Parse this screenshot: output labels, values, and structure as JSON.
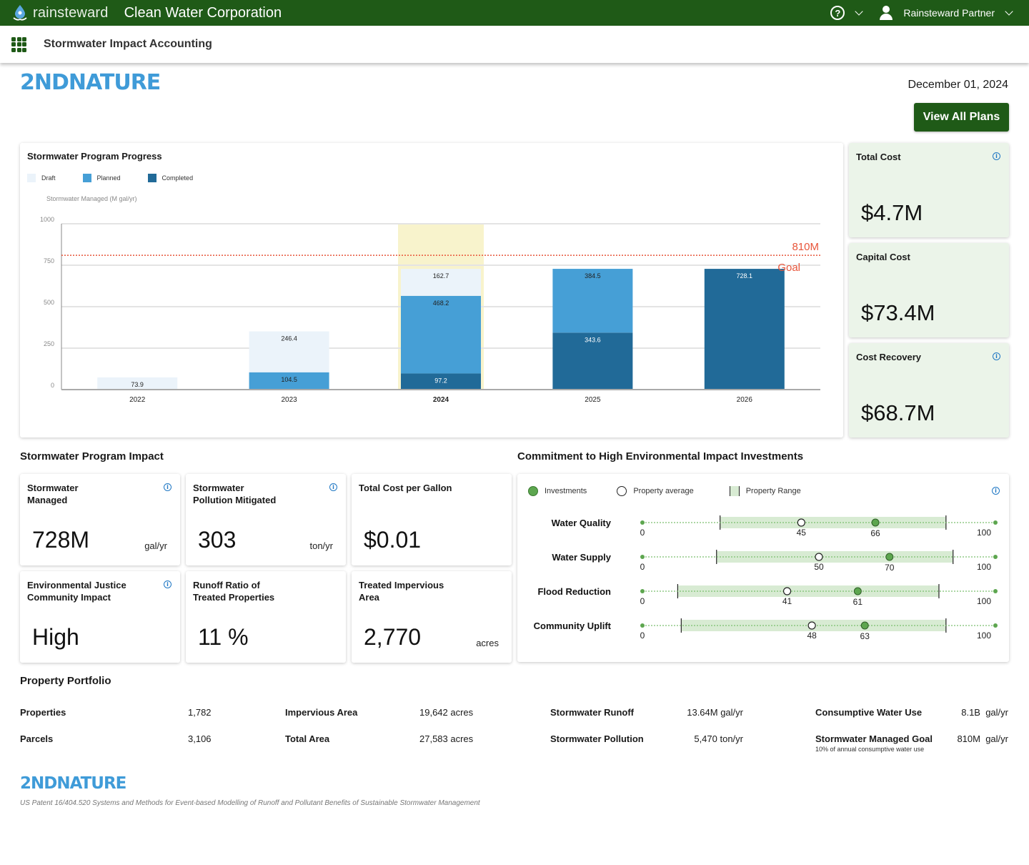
{
  "topbar": {
    "brand_name": "rainsteward",
    "org_name": "Clean Water Corporation",
    "help_icon": "question-circle-icon",
    "user_icon": "user-icon",
    "user_name": "Rainsteward Partner"
  },
  "subbar": {
    "apps_icon": "grid-apps-icon",
    "title": "Stormwater Impact Accounting"
  },
  "logo_text": "2NDNATURE",
  "date": "December 01,  2024",
  "view_all_plans_label": "View All Plans",
  "chart_card": {
    "title": "Stormwater Program Progress"
  },
  "chart_data": {
    "type": "bar",
    "stacked": true,
    "title": "Stormwater Program Progress",
    "xlabel": "",
    "ylabel": "Stormwater Managed (M gal/yr)",
    "ylim": [
      0,
      1000
    ],
    "yticks": [
      0,
      250,
      500,
      750,
      1000
    ],
    "categories": [
      "2022",
      "2023",
      "2024",
      "2025",
      "2026"
    ],
    "highlight_category": "2024",
    "series": [
      {
        "name": "Completed",
        "color": "#216a98",
        "values": [
          0,
          0,
          97.2,
          343.6,
          728.1
        ],
        "labels": [
          null,
          null,
          "97.2",
          "343.6",
          "728.1"
        ]
      },
      {
        "name": "Planned",
        "color": "#469fd6",
        "values": [
          0,
          104.5,
          468.2,
          384.5,
          0
        ],
        "labels": [
          null,
          "104.5",
          "468.2",
          "384.5",
          null
        ]
      },
      {
        "name": "Draft",
        "color": "#ebf3fa",
        "values": [
          73.9,
          246.4,
          162.7,
          0,
          0
        ],
        "labels": [
          "73.9",
          "246.4",
          "162.7",
          null,
          null
        ]
      }
    ],
    "legend": [
      "Draft",
      "Planned",
      "Completed"
    ],
    "legend_position": "top-left",
    "grid": true,
    "goal_line": {
      "value": 810,
      "label_top": "810M",
      "label_bottom": "Goal",
      "color": "#e8553a"
    }
  },
  "cost_cards": [
    {
      "title": "Total Cost",
      "value": "$4.7M",
      "info": true
    },
    {
      "title": "Capital Cost",
      "value": "$73.4M",
      "info": false
    },
    {
      "title": "Cost Recovery",
      "value": "$68.7M",
      "info": true
    }
  ],
  "impact_section": {
    "title": "Stormwater Program Impact",
    "cards": [
      {
        "title_line1": "Stormwater",
        "title_line2": "Managed",
        "value": "728M",
        "unit": "gal/yr",
        "info": true
      },
      {
        "title_line1": "Stormwater",
        "title_line2": "Pollution Mitigated",
        "value": "303",
        "unit": "ton/yr",
        "info": true
      },
      {
        "title_line1": "Total Cost per Gallon",
        "title_line2": "",
        "value": "$0.01",
        "unit": "",
        "info": false
      },
      {
        "title_line1": "Environmental Justice",
        "title_line2": "Community Impact",
        "value": "High",
        "unit": "",
        "info": true
      },
      {
        "title_line1": "Runoff Ratio of",
        "title_line2": "Treated Properties",
        "value": "11 %",
        "unit": "",
        "info": false
      },
      {
        "title_line1": "Treated Impervious",
        "title_line2": "Area",
        "value": "2,770",
        "unit": "acres",
        "info": false
      }
    ]
  },
  "commitment": {
    "title": "Commitment to High Environmental Impact Investments",
    "legend": {
      "investments": "Investments",
      "average": "Property average",
      "range": "Property Range"
    },
    "scale_min": "0",
    "scale_max": "100",
    "rows": [
      {
        "label": "Water Quality",
        "average": 45,
        "investment": 66,
        "range_min": 22,
        "range_max": 86
      },
      {
        "label": "Water Supply",
        "average": 50,
        "investment": 70,
        "range_min": 21,
        "range_max": 88
      },
      {
        "label": "Flood Reduction",
        "average": 41,
        "investment": 61,
        "range_min": 10,
        "range_max": 84
      },
      {
        "label": "Community Uplift",
        "average": 48,
        "investment": 63,
        "range_min": 11,
        "range_max": 86
      }
    ]
  },
  "portfolio": {
    "title": "Property Portfolio",
    "items": [
      {
        "label": "Properties",
        "value": "1,782"
      },
      {
        "label": "Parcels",
        "value": "3,106"
      },
      {
        "label": "Impervious Area",
        "value": "19,642 acres"
      },
      {
        "label": "Total Area",
        "value": "27,583 acres"
      },
      {
        "label": "Stormwater Runoff",
        "value": "13.64M gal/yr"
      },
      {
        "label": "Stormwater Pollution",
        "value": "5,470 ton/yr"
      },
      {
        "label": "Consumptive Water Use",
        "value": "8.1B  gal/yr"
      },
      {
        "label": "Stormwater Managed Goal",
        "value": "810M  gal/yr",
        "sub": "10% of annual consumptive water use"
      }
    ]
  },
  "footer": {
    "logo_text": "2NDNATURE",
    "patent": "US Patent 16/404.520 Systems and Methods for Event-based Modelling of Runoff and Pollutant Benefits of Sustainable Stormwater Management"
  }
}
